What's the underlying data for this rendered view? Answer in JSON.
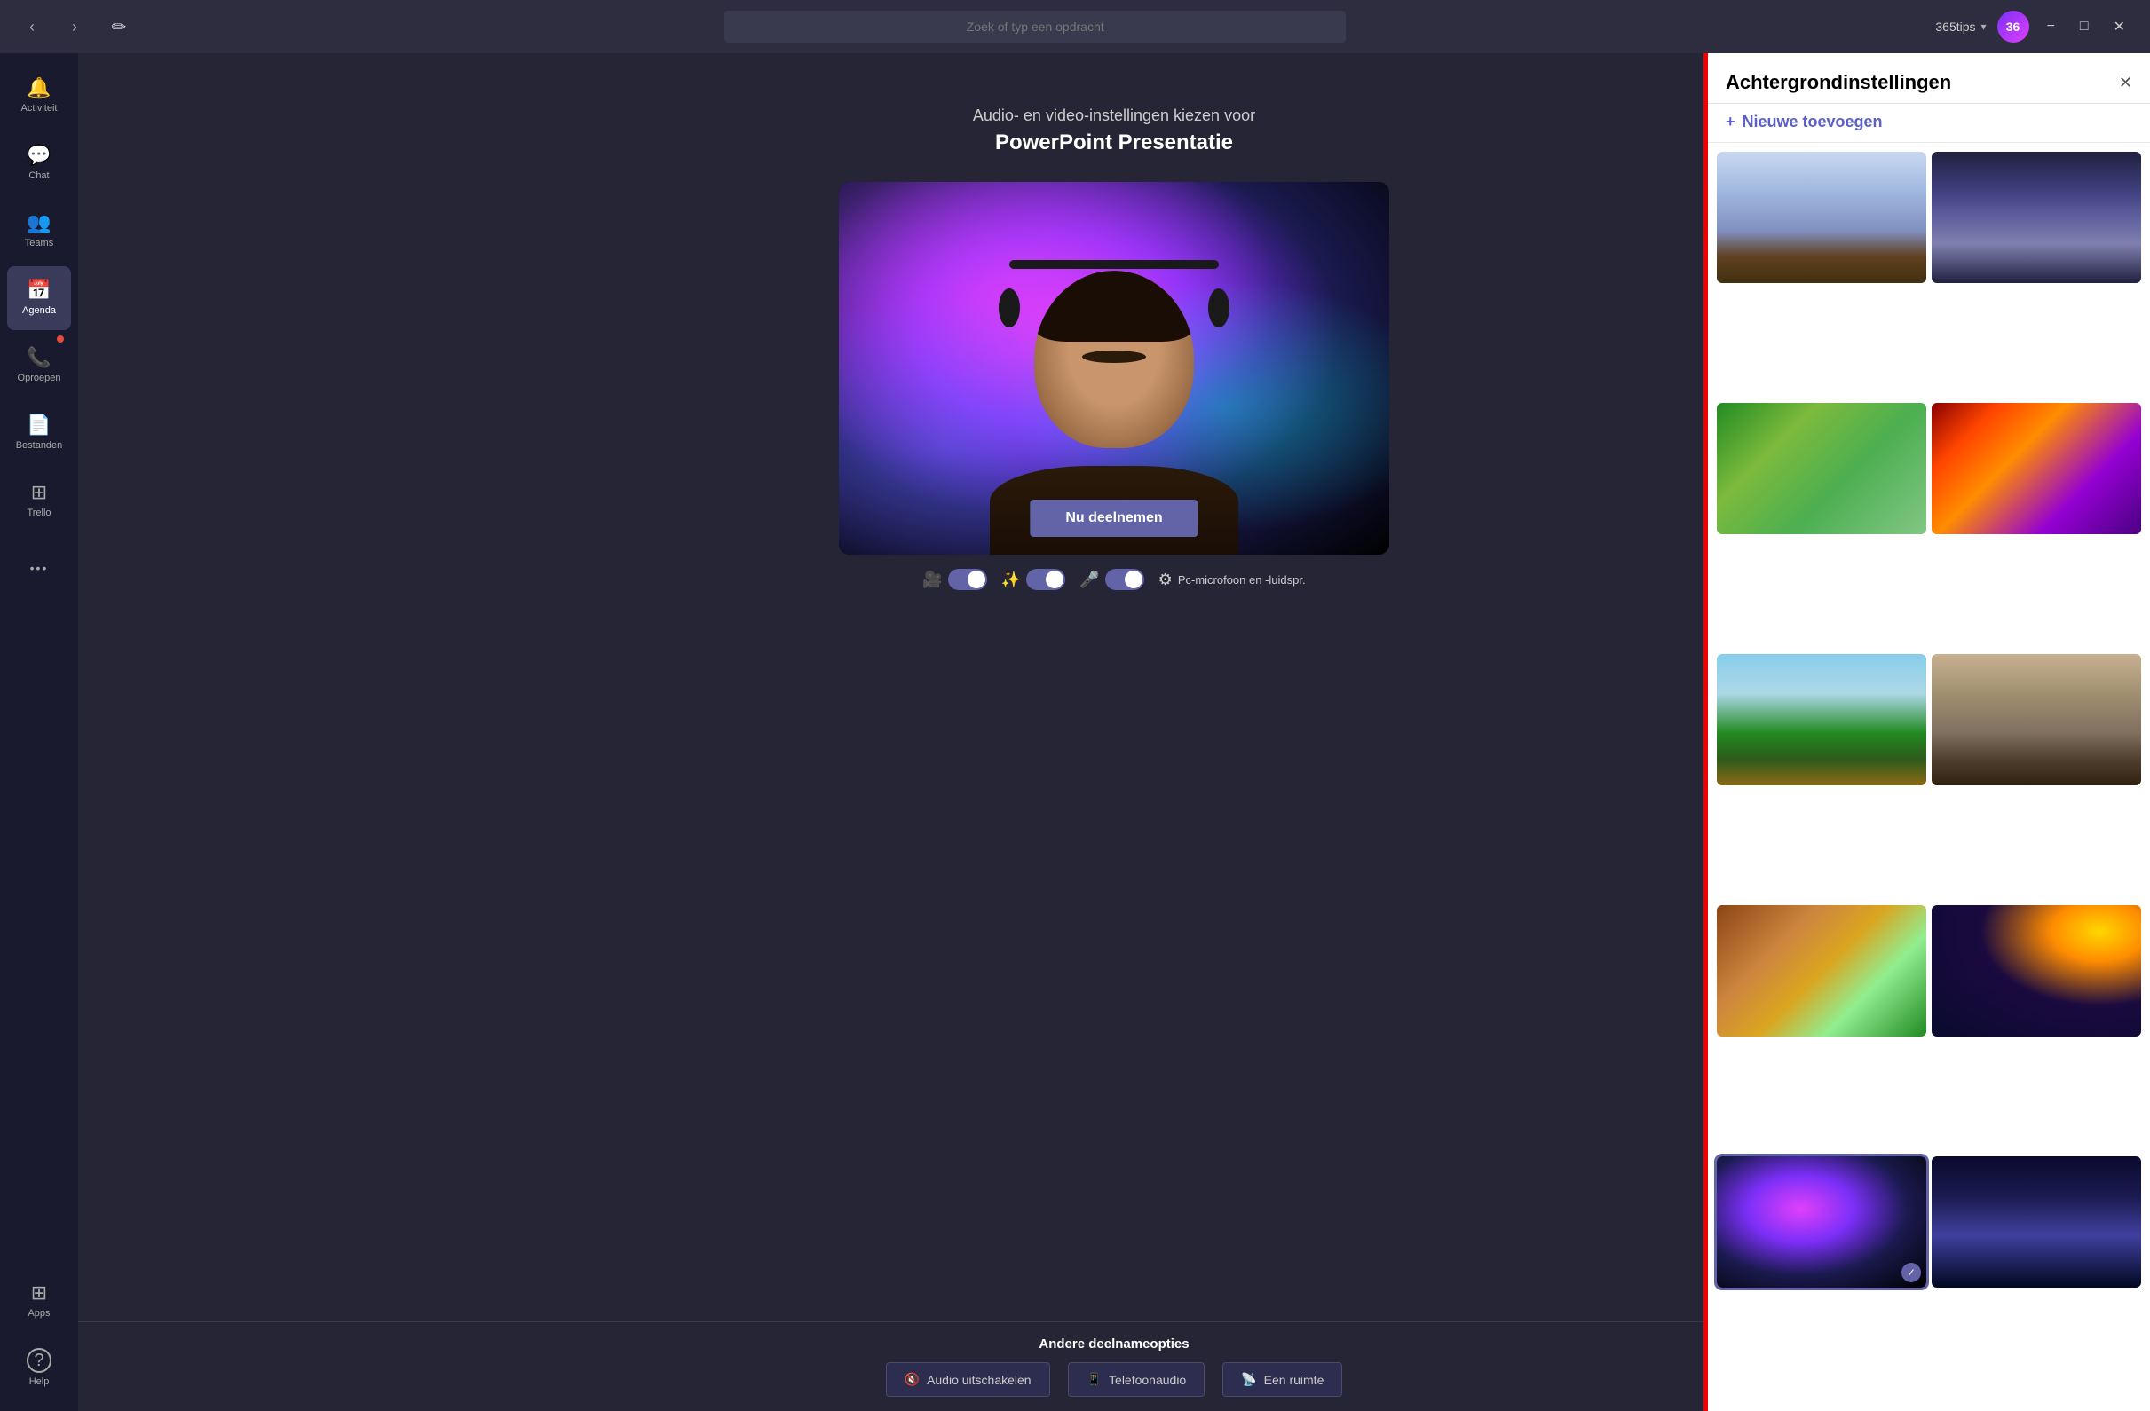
{
  "titlebar": {
    "nav_back": "‹",
    "nav_forward": "›",
    "compose_icon": "✏",
    "search_placeholder": "Zoek of typ een opdracht",
    "user_name": "365tips",
    "avatar_initials": "36",
    "minimize": "−",
    "maximize": "□",
    "close": "✕"
  },
  "sidebar": {
    "items": [
      {
        "id": "activiteit",
        "label": "Activiteit",
        "icon": "🔔",
        "active": false
      },
      {
        "id": "chat",
        "label": "Chat",
        "icon": "💬",
        "active": false
      },
      {
        "id": "teams",
        "label": "Teams",
        "icon": "👥",
        "active": false
      },
      {
        "id": "agenda",
        "label": "Agenda",
        "icon": "📅",
        "active": true
      },
      {
        "id": "oproepen",
        "label": "Oproepen",
        "icon": "📞",
        "active": false,
        "dot": true
      },
      {
        "id": "bestanden",
        "label": "Bestanden",
        "icon": "📄",
        "active": false
      },
      {
        "id": "trello",
        "label": "Trello",
        "icon": "⊞",
        "active": false
      },
      {
        "id": "more",
        "label": "···",
        "icon": "···",
        "active": false
      }
    ],
    "bottom_items": [
      {
        "id": "apps",
        "label": "Apps",
        "icon": "⊞"
      },
      {
        "id": "help",
        "label": "Help",
        "icon": "?"
      }
    ]
  },
  "meeting": {
    "subtitle": "Audio- en video-instellingen kiezen voor",
    "title": "PowerPoint Presentatie",
    "join_button": "Nu deelnemen",
    "other_options_label": "Andere deelnameopties",
    "audio_label": "Pc-microfoon en -luidspr.",
    "controls": {
      "video_on": true,
      "effects_on": true,
      "mic_on": true
    },
    "bottom_buttons": [
      {
        "id": "audio-uitschakelen",
        "icon": "🔇",
        "label": "Audio uitschakelen"
      },
      {
        "id": "telefoonaudio",
        "icon": "📱",
        "label": "Telefoonaudio"
      },
      {
        "id": "een-ruimte",
        "icon": "📡",
        "label": "Een ruimte"
      }
    ]
  },
  "bg_panel": {
    "title": "Achtergrondinstellingen",
    "close_icon": "✕",
    "add_label": "Nieuwe toevoegen",
    "thumbnails": [
      {
        "id": "classroom",
        "style": "bg-classroom",
        "selected": false
      },
      {
        "id": "corridor",
        "style": "bg-corridor",
        "selected": false
      },
      {
        "id": "minecraft-green",
        "style": "bg-minecraft-green",
        "selected": false
      },
      {
        "id": "minecraft-colorful",
        "style": "bg-minecraft-colorful",
        "selected": false
      },
      {
        "id": "mountains",
        "style": "bg-mountains",
        "selected": false
      },
      {
        "id": "ruins",
        "style": "bg-ruins",
        "selected": false
      },
      {
        "id": "fantasy-gate",
        "style": "bg-fantasy-gate",
        "selected": false
      },
      {
        "id": "space-planet",
        "style": "bg-space-planet",
        "selected": false
      },
      {
        "id": "galaxy",
        "style": "bg-galaxy",
        "selected": true
      },
      {
        "id": "fantasy-night",
        "style": "bg-fantasy-night",
        "selected": false
      }
    ]
  }
}
